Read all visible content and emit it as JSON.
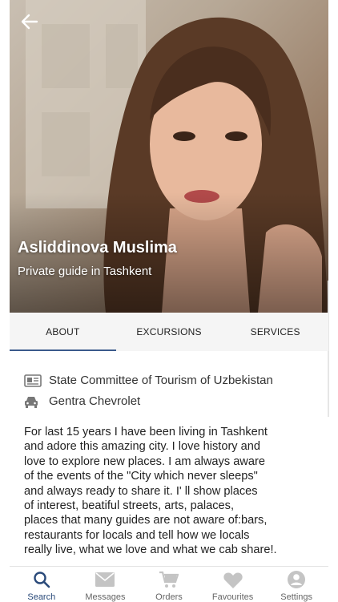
{
  "profile": {
    "name": "Asliddinova Muslima",
    "role": "Private guide in Tashkent"
  },
  "tabs": [
    {
      "label": "ABOUT",
      "active": true
    },
    {
      "label": "EXCURSIONS",
      "active": false
    },
    {
      "label": "SERVICES",
      "active": false
    }
  ],
  "details": {
    "organization": "State Committee of Tourism of Uzbekistan",
    "organization_icon": "id-card-icon",
    "car": "Gentra Chevrolet",
    "car_icon": "car-icon"
  },
  "bio_lines": [
    "For last 15 years I have been living in Tashkent",
    "and adore this amazing city. I love history and",
    "love to explore new places. I am always aware",
    "of the events of the \"City which never sleeps\"",
    "and always ready to share it. I' ll show places",
    "of interest, beatiful streets, arts, palaces,",
    "places that many guides are not aware of:bars,",
    "restaurants for locals and tell how we  locals",
    "really live, what we love and what we cab share!."
  ],
  "nav": [
    {
      "label": "Search",
      "icon": "search-icon",
      "active": true
    },
    {
      "label": "Messages",
      "icon": "mail-icon",
      "active": false
    },
    {
      "label": "Orders",
      "icon": "cart-icon",
      "active": false
    },
    {
      "label": "Favourites",
      "icon": "heart-icon",
      "active": false
    },
    {
      "label": "Settings",
      "icon": "user-icon",
      "active": false
    }
  ],
  "colors": {
    "accent": "#3b5a8c",
    "nav_active": "#2a4a7a",
    "nav_inactive": "#c4c4c4",
    "tab_bar": "#f5f5f5"
  }
}
